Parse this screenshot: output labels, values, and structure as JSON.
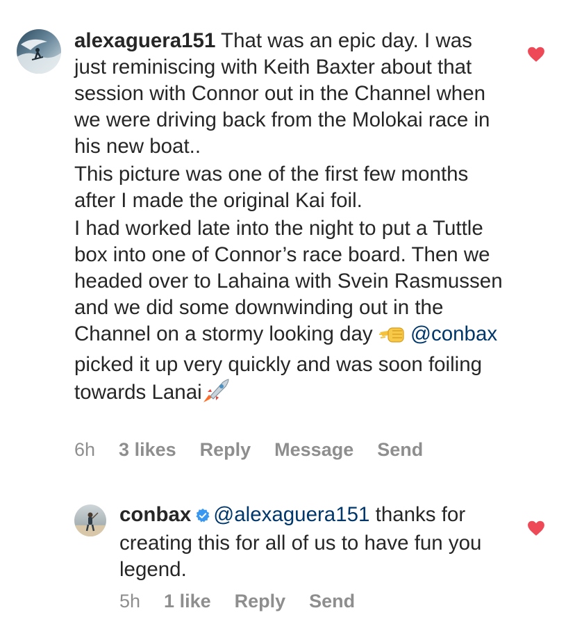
{
  "comments": [
    {
      "username": "alexaguera151",
      "paragraphs": [
        "That was an epic day. I was just reminiscing with Keith Baxter about that session with Connor out in the Channel when we were driving back from the Molokai race in his new boat..",
        "This picture was one of the first few months after I made the original Kai foil.",
        "I had worked late into the night to put  a Tuttle box into one of Connor’s race board. Then we headed over to Lahaina with Svein Rasmussen and we did some downwinding out in the Channel on a stormy looking day"
      ],
      "mention": "@conbax",
      "after_mention": " picked it up very quickly and was soon foiling towards Lanai",
      "emoji_fist": "fist-bump-emoji",
      "emoji_rocket": "rocket-emoji",
      "time": "6h",
      "likes": "3 likes",
      "reply_label": "Reply",
      "message_label": "Message",
      "send_label": "Send",
      "liked": true
    },
    {
      "username": "conbax",
      "verified": true,
      "mention": "@alexaguera151",
      "text": " thanks for creating this for all of us to have fun you legend.",
      "time": "5h",
      "likes": "1 like",
      "reply_label": "Reply",
      "send_label": "Send",
      "liked": true
    }
  ],
  "colors": {
    "text": "#262626",
    "meta": "#8e8e8e",
    "mention": "#00376b",
    "heart": "#ed4956",
    "verified": "#3897f0"
  }
}
